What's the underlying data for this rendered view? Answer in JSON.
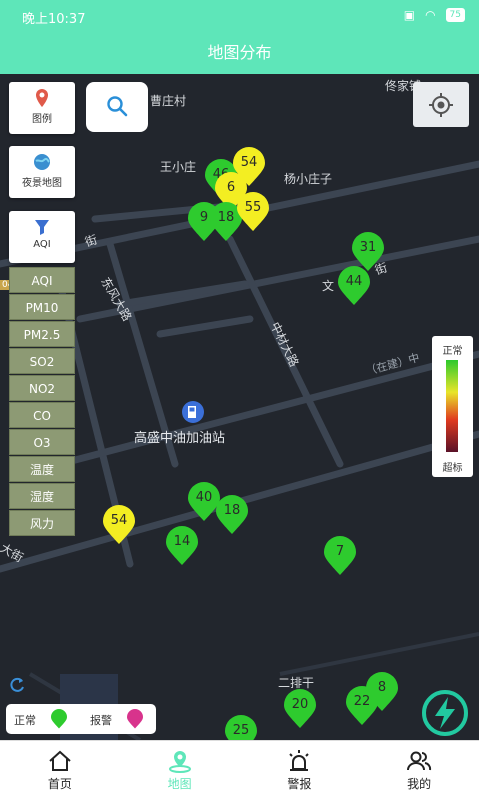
{
  "status": {
    "time": "晚上10:37",
    "battery": "75"
  },
  "header": {
    "title": "地图分布"
  },
  "map": {
    "labels": {
      "cao": "曹庄村",
      "tong": "佟家铺",
      "wang": "王小庄",
      "yang": "杨小庄子",
      "dongfeng": "东风大路",
      "zhongcai": "中材大路",
      "wenn": "文",
      "jie1": "街",
      "jie2": "街",
      "station": "高盛中油加油站",
      "construct": "（在建）中",
      "erpai": "二排干",
      "daj": "大街",
      "sideNum": "04"
    },
    "buttons": {
      "legend": "图例",
      "night": "夜景地图",
      "aqi": "AQI"
    },
    "metrics": [
      "AQI",
      "PM10",
      "PM2.5",
      "SO2",
      "NO2",
      "CO",
      "O3",
      "温度",
      "湿度",
      "风力"
    ],
    "scale": {
      "top": "正常",
      "bottom": "超标"
    },
    "legend": {
      "normal": "正常",
      "alarm": "报警"
    },
    "markers": [
      "46",
      "54",
      "6",
      "9",
      "18",
      "55",
      "31",
      "44",
      "40",
      "18",
      "54",
      "14",
      "7",
      "20",
      "22",
      "8",
      "25"
    ]
  },
  "nav": {
    "home": "首页",
    "map": "地图",
    "alarm": "警报",
    "me": "我的"
  },
  "colors": {
    "accent": "#5ee6b9",
    "normal": "#2ecb2e",
    "warn": "#f3ee22",
    "alarm": "#d8338c"
  }
}
